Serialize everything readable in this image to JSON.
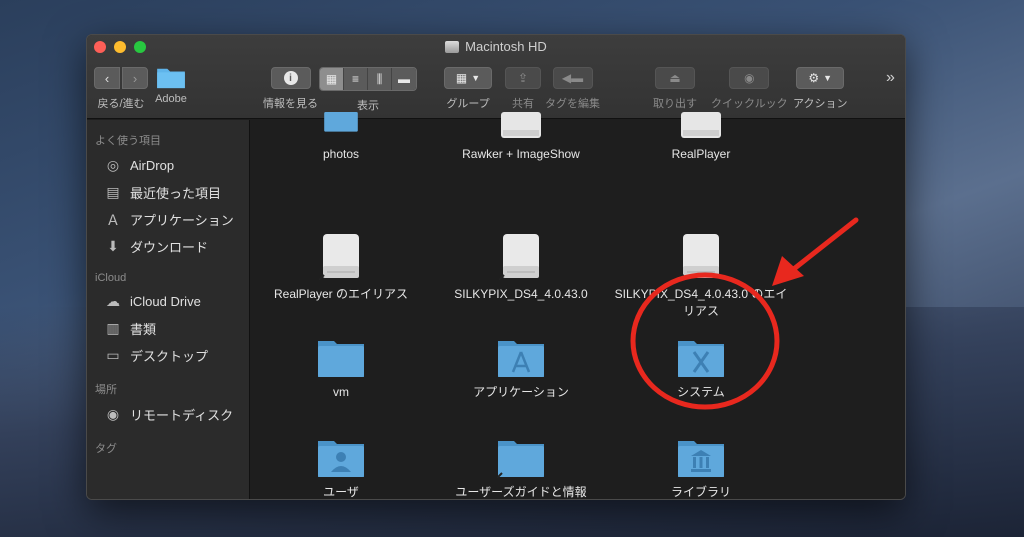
{
  "window": {
    "title": "Macintosh HD"
  },
  "toolbar": {
    "nav_label": "戻る/進む",
    "adobe_label": "Adobe",
    "info_label": "情報を見る",
    "view_label": "表示",
    "group_label": "グループ",
    "share_label": "共有",
    "tag_label": "タグを編集",
    "eject_label": "取り出す",
    "quicklook_label": "クイックルック",
    "action_label": "アクション",
    "more_glyph": "»"
  },
  "sidebar": {
    "favorites_header": "よく使う項目",
    "favorites": [
      {
        "label": "AirDrop",
        "icon": "airdrop-icon"
      },
      {
        "label": "最近使った項目",
        "icon": "recents-icon"
      },
      {
        "label": "アプリケーション",
        "icon": "applications-icon"
      },
      {
        "label": "ダウンロード",
        "icon": "downloads-icon"
      }
    ],
    "icloud_header": "iCloud",
    "icloud": [
      {
        "label": "iCloud Drive",
        "icon": "cloud-icon"
      },
      {
        "label": "書類",
        "icon": "documents-icon"
      },
      {
        "label": "デスクトップ",
        "icon": "desktop-icon"
      }
    ],
    "places_header": "場所",
    "places": [
      {
        "label": "リモートディスク",
        "icon": "disc-icon"
      }
    ],
    "tags_header": "タグ"
  },
  "files": [
    {
      "name": "photos",
      "kind": "folder"
    },
    {
      "name": "Rawker + ImageShow",
      "kind": "disk"
    },
    {
      "name": "RealPlayer",
      "kind": "disk"
    },
    {
      "name": "RealPlayer のエイリアス",
      "kind": "disk"
    },
    {
      "name": "SILKYPIX_DS4_4.0.43.0",
      "kind": "disk"
    },
    {
      "name": "SILKYPIX_DS4_4.0.43.0 のエイリアス",
      "kind": "disk"
    },
    {
      "name": "vm",
      "kind": "folder"
    },
    {
      "name": "アプリケーション",
      "kind": "folder-apps"
    },
    {
      "name": "システム",
      "kind": "folder-system"
    },
    {
      "name": "ユーザ",
      "kind": "folder-users"
    },
    {
      "name": "ユーザーズガイドと情報",
      "kind": "folder-alias"
    },
    {
      "name": "ライブラリ",
      "kind": "folder-library"
    }
  ],
  "colors": {
    "annotation": "#e8281e",
    "folder": "#5fa8dc"
  }
}
